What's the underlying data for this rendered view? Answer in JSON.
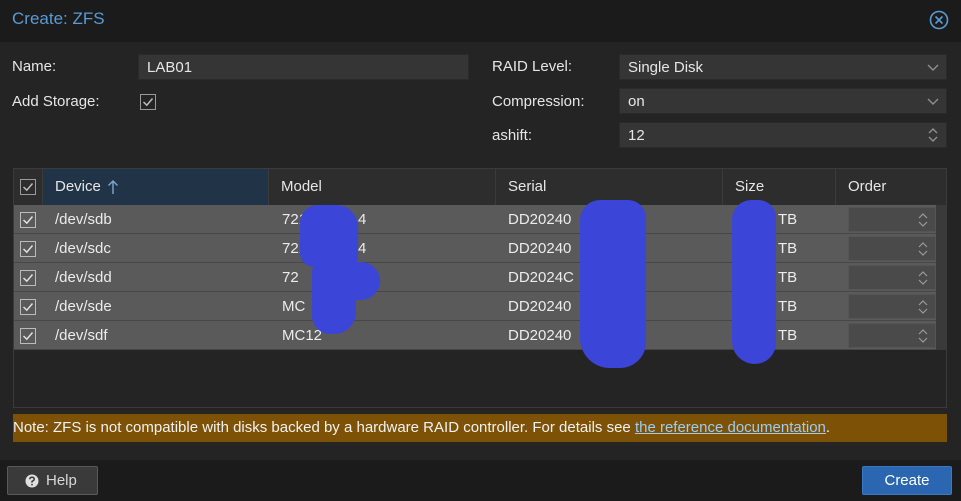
{
  "dialog": {
    "title": "Create: ZFS",
    "close_icon": "close-circle-icon"
  },
  "form": {
    "name_label": "Name:",
    "name_value": "LAB01",
    "add_storage_label": "Add Storage:",
    "add_storage_checked": true,
    "raid_label": "RAID Level:",
    "raid_value": "Single Disk",
    "compression_label": "Compression:",
    "compression_value": "on",
    "ashift_label": "ashift:",
    "ashift_value": "12"
  },
  "grid": {
    "columns": [
      "Device",
      "Model",
      "Serial",
      "Size",
      "Order"
    ],
    "sort_column": "Device",
    "sort_direction": "ascending",
    "rows": [
      {
        "device": "/dev/sdb",
        "model": "721",
        "model_tail": "4",
        "serial": "DD20240",
        "size": "TB",
        "checked": true
      },
      {
        "device": "/dev/sdc",
        "model": "721",
        "model_tail": "4",
        "serial": "DD20240",
        "size": "TB",
        "checked": true
      },
      {
        "device": "/dev/sdd",
        "model": "72",
        "model_tail": "L4",
        "serial": "DD2024C",
        "size": "TB",
        "checked": true
      },
      {
        "device": "/dev/sde",
        "model": "MC",
        "model_tail": "",
        "serial": "DD20240",
        "size": "TB",
        "checked": true
      },
      {
        "device": "/dev/sdf",
        "model": "MC12",
        "model_tail": "",
        "serial": "DD20240",
        "size": "TB",
        "checked": true
      }
    ]
  },
  "note": {
    "text": "Note: ZFS is not compatible with disks backed by a hardware RAID controller. For details see ",
    "link": "the reference documentation",
    "end": "."
  },
  "footer": {
    "help_label": "Help",
    "help_icon": "question-circle-icon",
    "create_label": "Create"
  },
  "colors": {
    "title": "#5a9ad5",
    "create_button": "#2a67b0",
    "note_bg": "#7d5206",
    "redaction": "#3b45d8"
  }
}
